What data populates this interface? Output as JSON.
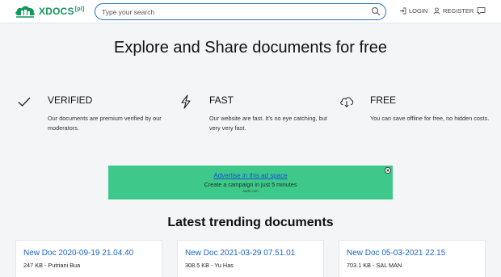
{
  "header": {
    "logo_text": "XDOCS",
    "logo_sup": "[pl]",
    "search_placeholder": "Type your search",
    "login_label": "LOGIN",
    "register_label": "REGISTER"
  },
  "hero": {
    "title": "Explore and Share documents for free"
  },
  "features": [
    {
      "title": "VERIFIED",
      "desc": "Our documents are premium verified by our moderators.",
      "icon": "checkmark-icon"
    },
    {
      "title": "FAST",
      "desc": "Our website are fast. It's no eye catching, but very very fast.",
      "icon": "lightning-icon"
    },
    {
      "title": "FREE",
      "desc": "You can save offline for free, no hidden costs.",
      "icon": "cloud-download-icon"
    }
  ],
  "ad": {
    "link": "Advertise in this ad space",
    "sub": "Create a campaign in just 5 minutes",
    "small": "aads.com",
    "bg_color": "#3ec98b"
  },
  "trending": {
    "title": "Latest trending documents",
    "cards": [
      {
        "title": "New Doc 2020-09-19 21.04.40",
        "meta": "247 KB - Putriani Bua"
      },
      {
        "title": "New Doc 2021-03-29 07.51.01",
        "meta": "308.5 KB - Yu Has"
      },
      {
        "title": "New Doc 05-03-2021 22.15",
        "meta": "703.1 KB - SAL MAN"
      }
    ]
  },
  "colors": {
    "brand": "#13965a",
    "link": "#1a66c9",
    "search_border": "#1a73c9"
  }
}
